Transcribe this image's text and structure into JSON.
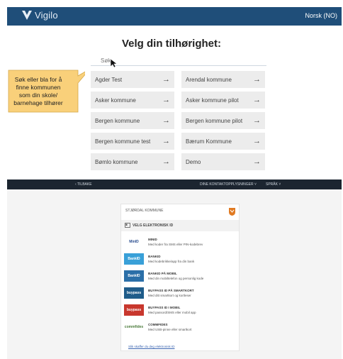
{
  "topbar": {
    "brand": "Vigilo",
    "language": "Norsk (NO)"
  },
  "page_title": "Velg din tilhørighet:",
  "search": {
    "placeholder": "Søk"
  },
  "tooltip": {
    "text": "Søk eller bla for å finne kommunen som din skole/ barnehage tilhører"
  },
  "arrow_glyph": "→",
  "municipalities": [
    "Agder Test",
    "Arendal kommune",
    "Asker kommune",
    "Asker kommune pilot",
    "Bergen kommune",
    "Bergen kommune pilot",
    "Bergen kommune test",
    "Bærum Kommune",
    "Bømlo kommune",
    "Demo"
  ],
  "login_nav": {
    "back": "‹  TILBAKE",
    "contact": "DINE KONTAKTOPPLYSNINGER  ˅",
    "language": "SPRÅK  ˅"
  },
  "login_card": {
    "municipality": "STJØRDAL KOMMUNE",
    "section": "VELG ELEKTRONISK ID",
    "options": [
      {
        "badge": "MinID",
        "name": "MINID",
        "desc": "Med koder fra SMS eller PIN-kodebrev",
        "color": "#ffffff",
        "text_color": "#2a4d8f"
      },
      {
        "badge": "BankID",
        "name": "BANKID",
        "desc": "Med kodebrikke/app fra din bank",
        "color": "#39a0d8",
        "text_color": "#ffffff"
      },
      {
        "badge": "BankID",
        "name": "BANKID PÅ MOBIL",
        "desc": "Med din mobiltelefon og personlig kode",
        "color": "#2b6fa8",
        "text_color": "#ffffff"
      },
      {
        "badge": "buypass",
        "name": "BUYPASS ID PÅ SMARTKORT",
        "desc": "Med ditt smartkort og kortleser",
        "color": "#1f5c8a",
        "text_color": "#ffffff"
      },
      {
        "badge": "buypass",
        "name": "BUYPASS ID I MOBIL",
        "desc": "Med passord/SMS eller mobil app",
        "color": "#c8372d",
        "text_color": "#ffffff"
      },
      {
        "badge": "commfides",
        "name": "COMMFIDES",
        "desc": "Med USB-pinne eller smartkort",
        "color": "#ffffff",
        "text_color": "#4a7a3a"
      }
    ],
    "link": "Slik skaffer du deg elektronisk ID"
  },
  "colors": {
    "topbar": "#1f4e79",
    "tooltip": "#f9d07a",
    "darkbar": "#1c2530"
  }
}
